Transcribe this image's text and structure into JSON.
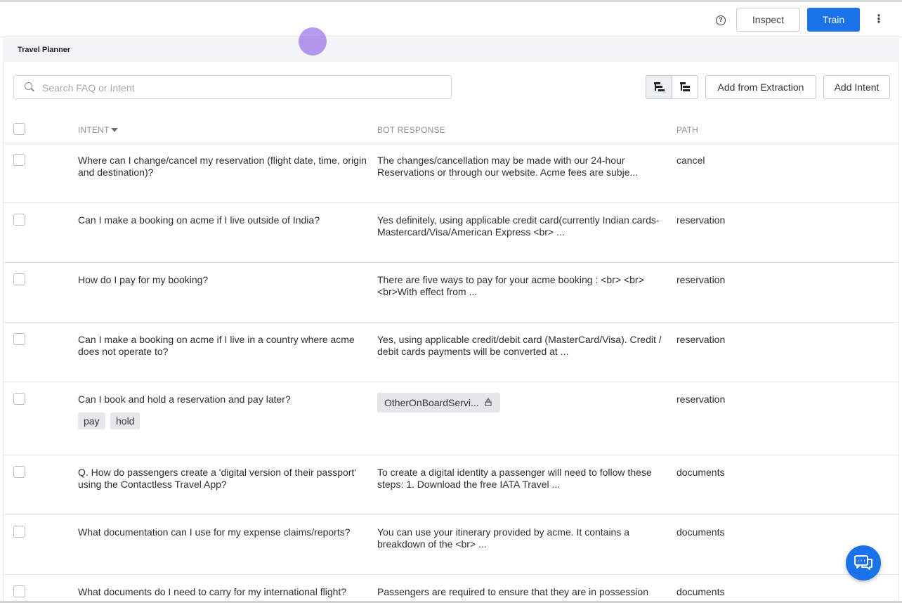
{
  "topbar": {
    "help_icon": "question-circle-icon",
    "inspect_label": "Inspect",
    "train_label": "Train",
    "more_icon": "vertical-ellipsis-icon",
    "accent": "#1a73e8"
  },
  "page": {
    "title": "Travel Planner"
  },
  "toolbar": {
    "search_placeholder": "Search FAQ or Intent",
    "search_value": "",
    "add_from_extraction_label": "Add from Extraction",
    "add_intent_label": "Add Intent"
  },
  "table": {
    "headers": {
      "intent": "INTENT",
      "response": "BOT RESPONSE",
      "path": "PATH"
    },
    "rows": [
      {
        "intent": "Where can I change/cancel my reservation (flight date, time, origin and destination)?",
        "response": "The changes/cancellation may be made with our 24-hour Reservations or through our website. Acme fees are subje...",
        "path": "cancel"
      },
      {
        "intent": "Can I make a booking on acme if I live outside of India?",
        "response": "Yes definitely, using applicable credit card(currently Indian cards- Mastercard/Visa/American Express <br> ...",
        "path": "reservation"
      },
      {
        "intent": "How do I pay for my booking?",
        "response": "There are five ways to pay for your acme booking : <br> <br> <br>With effect from ...",
        "path": "reservation"
      },
      {
        "intent": "Can I make a booking on acme if I live in a country where acme does not operate to?",
        "response": "Yes, using applicable credit/debit card (MasterCard/Visa). Credit / debit cards payments will be converted at ...",
        "path": "reservation"
      },
      {
        "intent": "Can I book and hold a reservation and pay later?",
        "response": "OtherOnBoardServi...",
        "path": "reservation",
        "tags": [
          "pay",
          "hold"
        ]
      },
      {
        "intent": "Q. How do passengers create a 'digital version of their passport' using the Contactless Travel App?",
        "response": "To create a digital identity a passenger will need to follow these steps: 1. Download the free IATA Travel ...",
        "path": "documents"
      },
      {
        "intent": "What documentation can I use for my expense claims/reports?",
        "response": "You can use your itinerary provided by acme. It contains a breakdown of the <br> ...",
        "path": "documents"
      },
      {
        "intent": "What documents do I need to carry for my international flight?",
        "response": "Passengers are required to ensure that they are in possession",
        "path": "documents"
      }
    ]
  },
  "chat_fab": {
    "icon": "chat-bubbles-icon"
  }
}
